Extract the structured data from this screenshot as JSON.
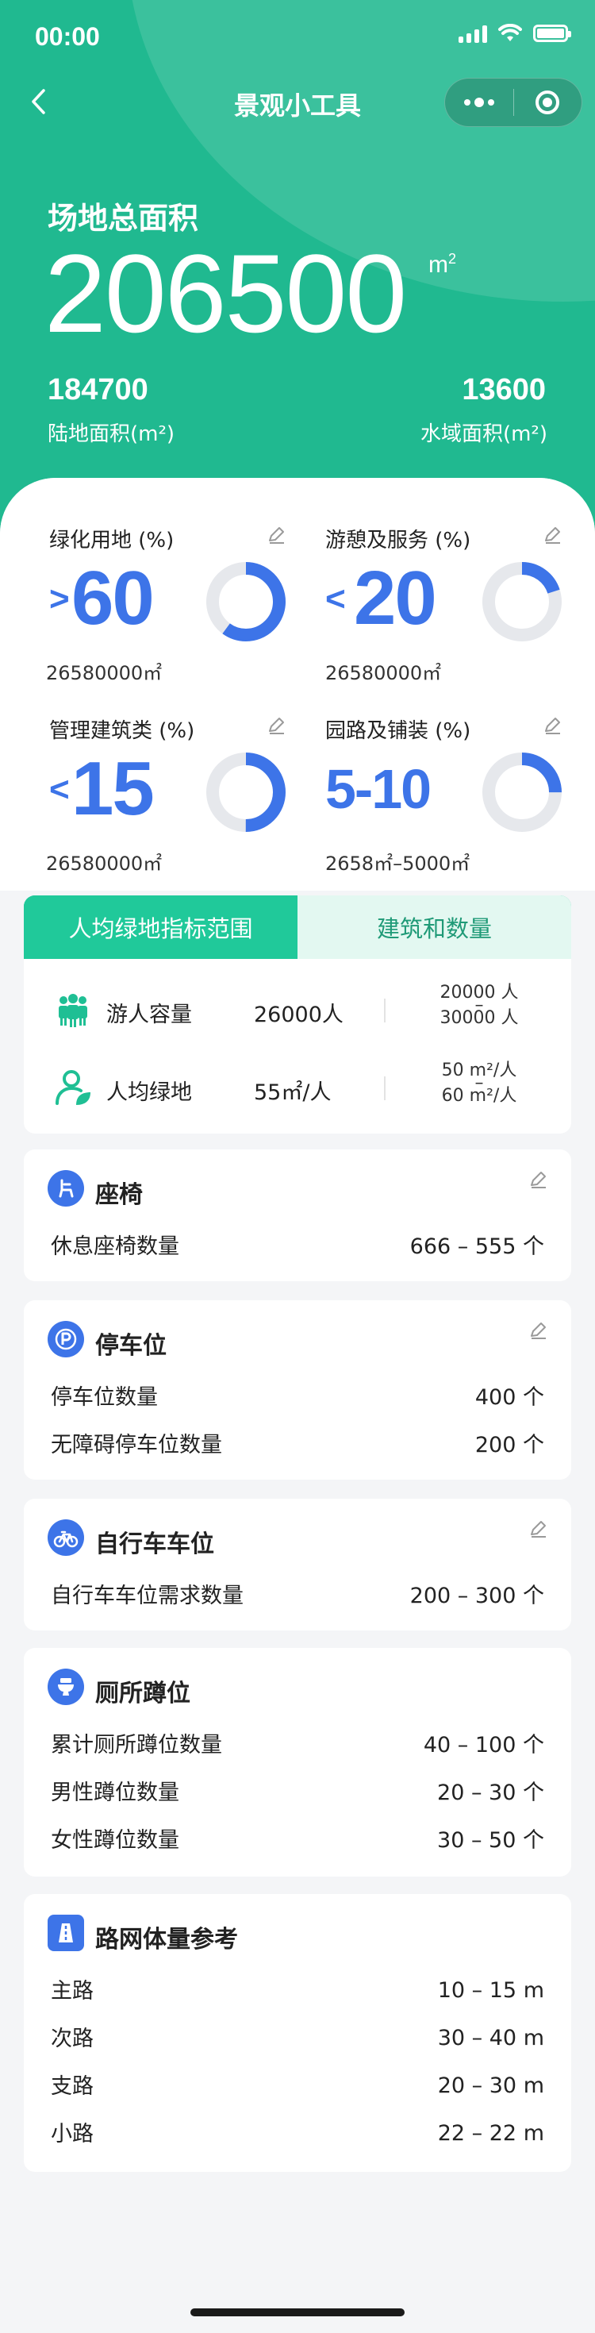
{
  "status_bar": {
    "time": "00:00"
  },
  "nav": {
    "title": "景观小工具"
  },
  "summary": {
    "total_label": "场地总面积",
    "total_value": "206500",
    "total_unit": "m",
    "total_unit_sup": "2",
    "land_value": "184700",
    "land_label": "陆地面积(m²)",
    "water_value": "13600",
    "water_label": "水域面积(m²)"
  },
  "metrics": [
    {
      "title": "绿化用地 (%)",
      "op": ">",
      "number": "60",
      "sub": "26580000㎡",
      "progress": 0.6
    },
    {
      "title": "游憩及服务 (%)",
      "op": "<",
      "number": "20",
      "sub": "26580000㎡",
      "progress": 0.2
    },
    {
      "title": "管理建筑类 (%)",
      "op": "<",
      "number": "15",
      "sub": "26580000㎡",
      "progress": 0.5
    },
    {
      "title": "园路及铺装 (%)",
      "op": "",
      "number": "5-10",
      "sub": "2658㎡–5000㎡",
      "progress": 0.25
    }
  ],
  "tabs": {
    "active": "人均绿地指标范围",
    "inactive": "建筑和数量",
    "rows": [
      {
        "icon": "people-icon",
        "label": "游人容量",
        "value": "26000人",
        "range_top": "20000 人",
        "range_mid": "–",
        "range_bottom": "30000 人"
      },
      {
        "icon": "person-leaf-icon",
        "label": "人均绿地",
        "value": "55㎡/人",
        "range_top": "50 m²/人",
        "range_mid": "–",
        "range_bottom": "60 m²/人"
      }
    ]
  },
  "sections": {
    "seat": {
      "title": "座椅",
      "rows": [
        {
          "label": "休息座椅数量",
          "value": "666 – 555 个"
        }
      ]
    },
    "parking": {
      "title": "停车位",
      "rows": [
        {
          "label": "停车位数量",
          "value": "400 个"
        },
        {
          "label": "无障碍停车位数量",
          "value": "200 个"
        }
      ]
    },
    "bike": {
      "title": "自行车车位",
      "rows": [
        {
          "label": "自行车车位需求数量",
          "value": "200 – 300 个"
        }
      ]
    },
    "toilet": {
      "title": "厕所蹲位",
      "rows": [
        {
          "label": "累计厕所蹲位数量",
          "value": "40 – 100 个"
        },
        {
          "label": "男性蹲位数量",
          "value": "20 – 30 个"
        },
        {
          "label": "女性蹲位数量",
          "value": "30 – 50 个"
        }
      ]
    },
    "road": {
      "title": "路网体量参考",
      "rows": [
        {
          "label": "主路",
          "value": "10 – 15 m"
        },
        {
          "label": "次路",
          "value": "30 – 40 m"
        },
        {
          "label": "支路",
          "value": "20 – 30 m"
        },
        {
          "label": "小路",
          "value": "22 – 22 m"
        }
      ]
    }
  },
  "colors": {
    "primary": "#20b990",
    "accent_blue": "#3d74e8",
    "ring_track": "#e6e8ec",
    "background": "#f4f5f7"
  }
}
